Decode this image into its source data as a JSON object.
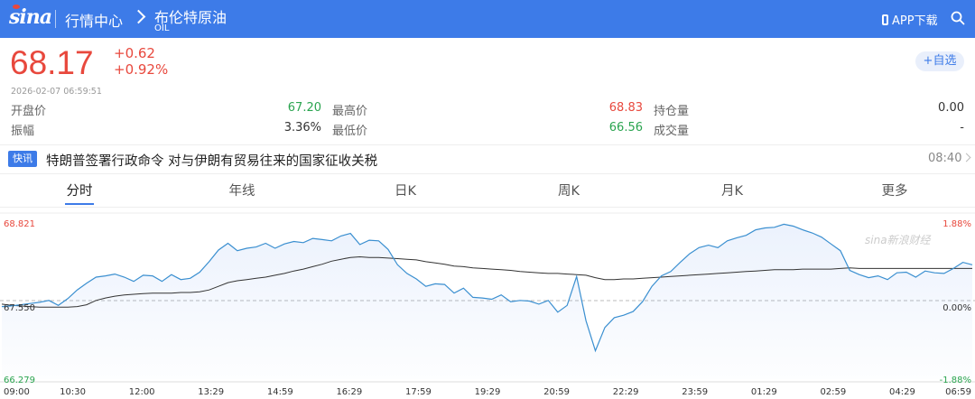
{
  "header": {
    "logo_text": "sina",
    "nav_home": "行情中心",
    "instrument_name": "布伦特原油",
    "instrument_code": "OIL",
    "app_download": "APP下载",
    "colors": {
      "bar": "#3d7be8",
      "up": "#e8483d",
      "down": "#2aa44f"
    }
  },
  "quote": {
    "price": "68.17",
    "change": "+0.62",
    "change_pct": "+0.92%",
    "timestamp": "2026-02-07   06:59:51",
    "watch_button": "+自选"
  },
  "stats": {
    "open_label": "开盘价",
    "open": "67.20",
    "high_label": "最高价",
    "high": "68.83",
    "oi_label": "持仓量",
    "oi": "0.00",
    "amp_label": "振幅",
    "amp": "3.36%",
    "low_label": "最低价",
    "low": "66.56",
    "vol_label": "成交量",
    "vol": "-"
  },
  "news": {
    "tag": "快讯",
    "headline": "特朗普签署行政命令 对与伊朗有贸易往来的国家征收关税",
    "time": "08:40"
  },
  "tabs": [
    "分时",
    "年线",
    "日K",
    "周K",
    "月K",
    "更多"
  ],
  "chart_data": {
    "type": "line",
    "watermark": "sina新浪财经",
    "y_left_labels": [
      "68.821",
      "67.550",
      "66.279"
    ],
    "y_right_labels": [
      "1.88%",
      "0.00%",
      "-1.88%"
    ],
    "ylim": [
      66.279,
      68.821
    ],
    "prev_close": 67.55,
    "x_tick_labels": [
      "09:00",
      "10:30",
      "12:00",
      "13:29",
      "14:59",
      "16:29",
      "17:59",
      "19:29",
      "20:59",
      "22:29",
      "23:59",
      "01:29",
      "02:59",
      "04:29",
      "06:59"
    ],
    "series": [
      {
        "kind": "price",
        "values": [
          67.46,
          67.47,
          67.49,
          67.51,
          67.53,
          67.56,
          67.48,
          67.59,
          67.73,
          67.84,
          67.94,
          67.96,
          67.99,
          67.94,
          67.87,
          67.97,
          67.96,
          67.87,
          67.98,
          67.9,
          67.92,
          68.02,
          68.19,
          68.38,
          68.49,
          68.37,
          68.41,
          68.43,
          68.49,
          68.41,
          68.48,
          68.52,
          68.5,
          68.57,
          68.55,
          68.53,
          68.61,
          68.65,
          68.47,
          68.54,
          68.53,
          68.39,
          68.14,
          68.0,
          67.91,
          67.79,
          67.83,
          67.82,
          67.68,
          67.76,
          67.61,
          67.6,
          67.58,
          67.65,
          67.54,
          67.56,
          67.55,
          67.5,
          67.56,
          67.37,
          67.48,
          67.95,
          67.23,
          66.74,
          67.12,
          67.28,
          67.32,
          67.38,
          67.54,
          67.79,
          67.96,
          68.03,
          68.18,
          68.32,
          68.42,
          68.46,
          68.42,
          68.53,
          68.58,
          68.62,
          68.71,
          68.74,
          68.75,
          68.8,
          68.77,
          68.71,
          68.66,
          68.59,
          68.48,
          68.37,
          68.05,
          67.98,
          67.93,
          67.96,
          67.9,
          68.01,
          68.02,
          67.94,
          68.04,
          68.01,
          68.0,
          68.08,
          68.18,
          68.14
        ]
      },
      {
        "kind": "average",
        "values": [
          67.5,
          67.48,
          67.47,
          67.46,
          67.45,
          67.45,
          67.45,
          67.45,
          67.46,
          67.49,
          67.56,
          67.6,
          67.63,
          67.65,
          67.66,
          67.67,
          67.68,
          67.68,
          67.68,
          67.69,
          67.69,
          67.7,
          67.73,
          67.79,
          67.85,
          67.88,
          67.9,
          67.92,
          67.94,
          67.97,
          68.0,
          68.04,
          68.07,
          68.11,
          68.15,
          68.2,
          68.23,
          68.26,
          68.27,
          68.26,
          68.26,
          68.25,
          68.24,
          68.23,
          68.22,
          68.19,
          68.17,
          68.15,
          68.12,
          68.11,
          68.09,
          68.08,
          68.07,
          68.06,
          68.05,
          68.03,
          68.02,
          68.01,
          68.0,
          68.0,
          67.99,
          67.98,
          67.97,
          67.93,
          67.9,
          67.9,
          67.91,
          67.91,
          67.92,
          67.93,
          67.94,
          67.95,
          67.96,
          67.97,
          67.98,
          67.99,
          68.0,
          68.01,
          68.02,
          68.03,
          68.04,
          68.05,
          68.06,
          68.06,
          68.06,
          68.07,
          68.07,
          68.07,
          68.07,
          68.08,
          68.09,
          68.08,
          68.08,
          68.08,
          68.08,
          68.08,
          68.08,
          68.08,
          68.08,
          68.08,
          68.08,
          68.08,
          68.08,
          68.08
        ]
      }
    ]
  }
}
